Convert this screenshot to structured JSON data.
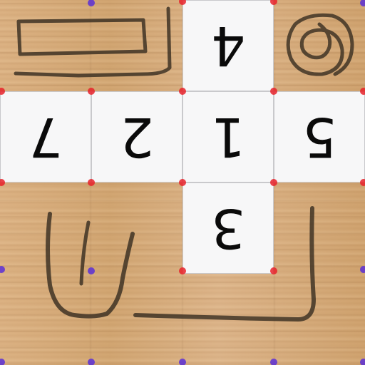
{
  "game": {
    "tiles": [
      {
        "label": "4",
        "rotation": 180
      },
      {
        "label": "7",
        "rotation": 180
      },
      {
        "label": "2",
        "rotation": 180
      },
      {
        "label": "1",
        "rotation": 180
      },
      {
        "label": "5",
        "rotation": 180
      },
      {
        "label": "3",
        "rotation": 180
      }
    ],
    "colors": {
      "tile_corner_dot": "#e8222a",
      "grid_dot": "#5a2fd6",
      "sketch_ink": "#3a2f22"
    }
  }
}
